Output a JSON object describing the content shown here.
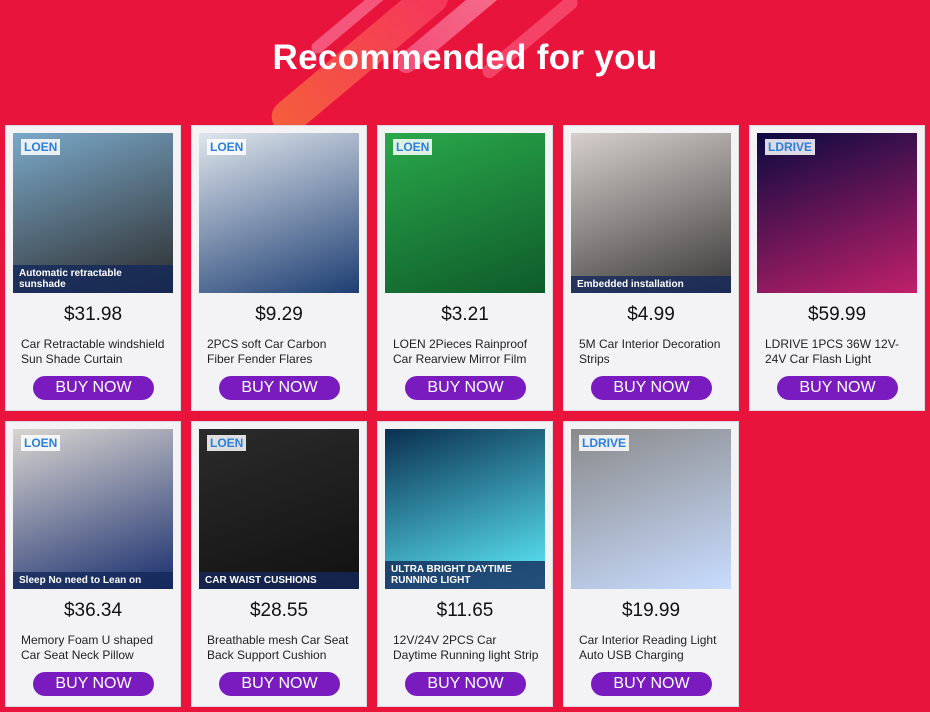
{
  "header": {
    "title": "Recommended for you"
  },
  "products": [
    {
      "name": "Car Retractable windshield Sun Shade Curtain",
      "price": "$31.98",
      "button": "BUY NOW",
      "image_brand": "LOEN",
      "image_caption": "Automatic retractable sunshade",
      "image_colors": [
        "#7aa8c8",
        "#2c2c2c"
      ]
    },
    {
      "name": "2PCS soft Car Carbon Fiber Fender Flares",
      "price": "$9.29",
      "button": "BUY NOW",
      "image_brand": "LOEN",
      "image_caption": "",
      "image_colors": [
        "#dfe5ec",
        "#1e3f73"
      ]
    },
    {
      "name": "LOEN 2Pieces Rainproof Car Rearview Mirror Film",
      "price": "$3.21",
      "button": "BUY NOW",
      "image_brand": "LOEN",
      "image_caption": "",
      "image_colors": [
        "#2aa84a",
        "#0e5b2a"
      ]
    },
    {
      "name": "5M Car Interior Decoration Strips",
      "price": "$4.99",
      "button": "BUY NOW",
      "image_brand": "",
      "image_caption": "Embedded installation",
      "image_colors": [
        "#d6cfcc",
        "#3a3a3a"
      ]
    },
    {
      "name": "LDRIVE 1PCS 36W 12V-24V Car Flash Light",
      "price": "$59.99",
      "button": "BUY NOW",
      "image_brand": "LDRIVE",
      "image_caption": "",
      "image_colors": [
        "#0a0a40",
        "#c0206a"
      ]
    },
    {
      "name": "Memory Foam U shaped Car Seat Neck Pillow",
      "price": "$36.34",
      "button": "BUY NOW",
      "image_brand": "LOEN",
      "image_caption": "Sleep No need to Lean on",
      "image_colors": [
        "#d8d4d0",
        "#1a2f6e"
      ]
    },
    {
      "name": "Breathable mesh Car Seat Back Support Cushion",
      "price": "$28.55",
      "button": "BUY NOW",
      "image_brand": "LOEN",
      "image_caption": "CAR WAIST CUSHIONS",
      "image_colors": [
        "#2b2b2b",
        "#111111"
      ]
    },
    {
      "name": "12V/24V 2PCS Car Daytime Running light Strip",
      "price": "$11.65",
      "button": "BUY NOW",
      "image_brand": "",
      "image_caption": "ULTRA BRIGHT DAYTIME RUNNING LIGHT",
      "image_colors": [
        "#0a3050",
        "#5ef0ff"
      ]
    },
    {
      "name": "Car Interior Reading Light Auto USB Charging",
      "price": "$19.99",
      "button": "BUY NOW",
      "image_brand": "LDRIVE",
      "image_caption": "",
      "image_colors": [
        "#8a8a8a",
        "#c8dcff"
      ]
    }
  ]
}
